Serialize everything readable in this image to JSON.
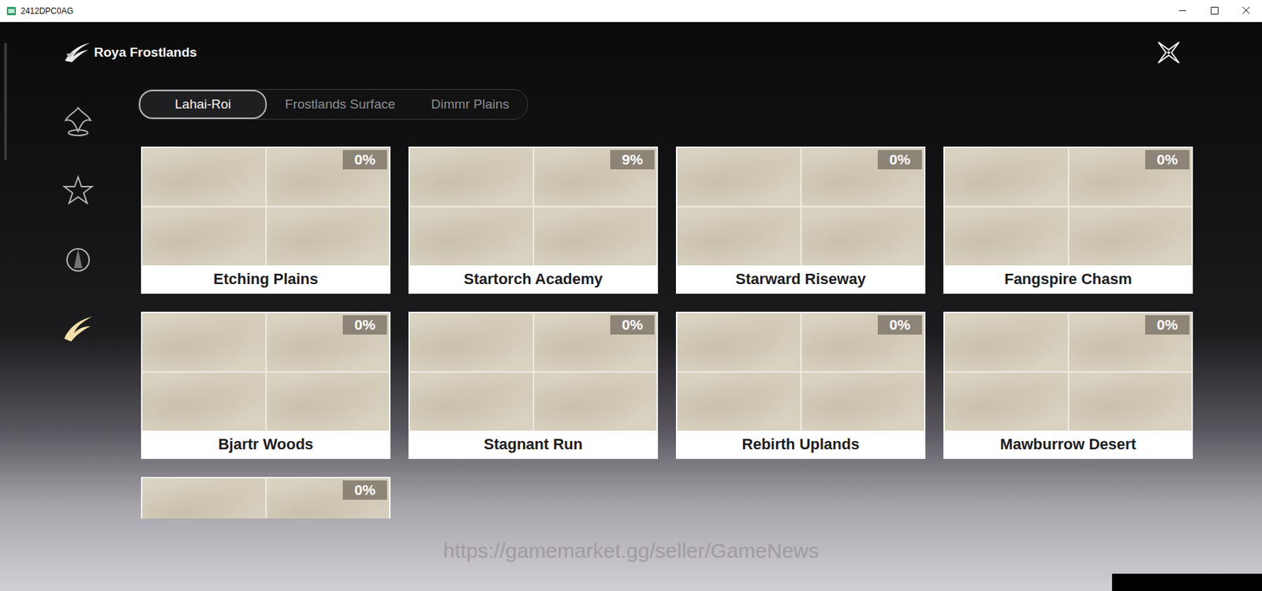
{
  "window": {
    "title": "2412DPC0AG"
  },
  "header": {
    "title": "Roya Frostlands"
  },
  "sidebar": [
    {
      "selected": false
    },
    {
      "selected": false
    },
    {
      "selected": false
    },
    {
      "selected": true
    }
  ],
  "tabs": [
    {
      "label": "Lahai-Roi",
      "selected": true
    },
    {
      "label": "Frostlands Surface",
      "selected": false
    },
    {
      "label": "Dimmr Plains",
      "selected": false
    }
  ],
  "regions": [
    {
      "name": "Etching Plains",
      "progress": "0%"
    },
    {
      "name": "Startorch Academy",
      "progress": "9%"
    },
    {
      "name": "Starward Riseway",
      "progress": "0%"
    },
    {
      "name": "Fangspire Chasm",
      "progress": "0%"
    },
    {
      "name": "Bjartr Woods",
      "progress": "0%"
    },
    {
      "name": "Stagnant Run",
      "progress": "0%"
    },
    {
      "name": "Rebirth Uplands",
      "progress": "0%"
    },
    {
      "name": "Mawburrow Desert",
      "progress": "0%"
    },
    {
      "progress": "0%"
    }
  ],
  "watermark": "https://gamemarket.gg/seller/GameNews"
}
